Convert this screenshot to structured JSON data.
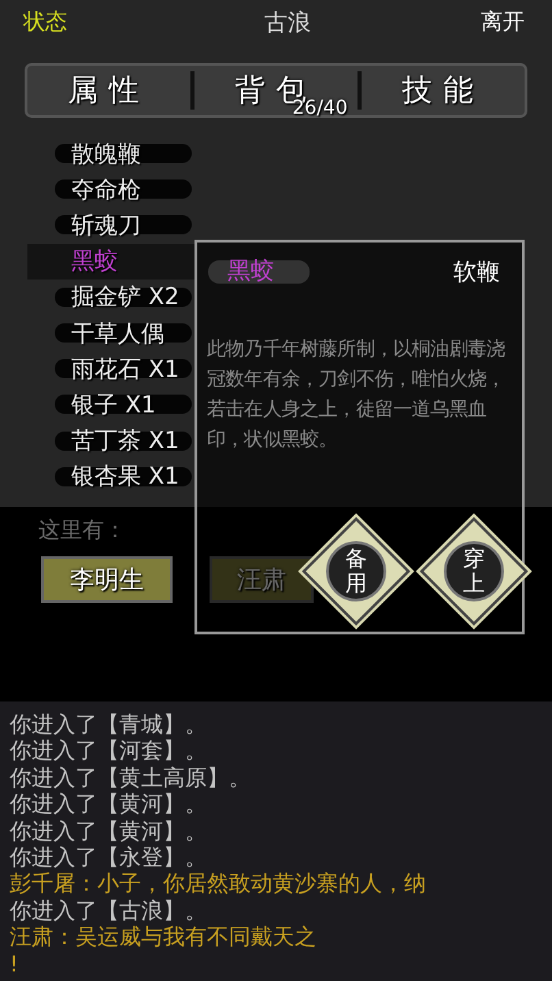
{
  "header": {
    "status_label": "状态",
    "location": "古浪",
    "leave_label": "离开"
  },
  "tabs": [
    {
      "label": "属性"
    },
    {
      "label": "背包",
      "count": "26/40"
    },
    {
      "label": "技能"
    }
  ],
  "inventory": [
    {
      "name": "散魄鞭",
      "selected": false
    },
    {
      "name": "夺命枪",
      "selected": false
    },
    {
      "name": "斩魂刀",
      "selected": false
    },
    {
      "name": "黑蛟",
      "selected": true
    },
    {
      "name": "掘金铲 X2",
      "selected": false
    },
    {
      "name": "干草人偶",
      "selected": false
    },
    {
      "name": "雨花石 X1",
      "selected": false
    },
    {
      "name": "银子 X1",
      "selected": false
    },
    {
      "name": "苦丁茶 X1",
      "selected": false
    },
    {
      "name": "银杏果 X1",
      "selected": false
    }
  ],
  "item_detail": {
    "name": "黑蛟",
    "type": "软鞭",
    "description": "此物乃千年树藤所制，以桐油剧毒浇冠数年有余，刀剑不伤，唯怕火烧，若击在人身之上，徒留一道乌黑血印，状似黑蛟。",
    "actions": [
      "备用",
      "穿上"
    ]
  },
  "nearby": {
    "label": "这里有：",
    "npcs": [
      {
        "name": "李明生"
      },
      {
        "name": "汪肃"
      }
    ]
  },
  "log": [
    {
      "kind": "system",
      "text": "你进入了【青城】。"
    },
    {
      "kind": "system",
      "text": "你进入了【河套】。"
    },
    {
      "kind": "system",
      "text": "你进入了【黄土高原】。"
    },
    {
      "kind": "system",
      "text": "你进入了【黄河】。"
    },
    {
      "kind": "system",
      "text": "你进入了【黄河】。"
    },
    {
      "kind": "system",
      "text": "你进入了【永登】。"
    },
    {
      "kind": "speech",
      "text": "彭千屠：小子，你居然敢动黄沙寨的人，纳"
    },
    {
      "kind": "system",
      "text": "你进入了【古浪】。"
    },
    {
      "kind": "speech",
      "text": "汪肃：吴运威与我有不同戴天之"
    },
    {
      "kind": "speech",
      "text": "!"
    }
  ]
}
